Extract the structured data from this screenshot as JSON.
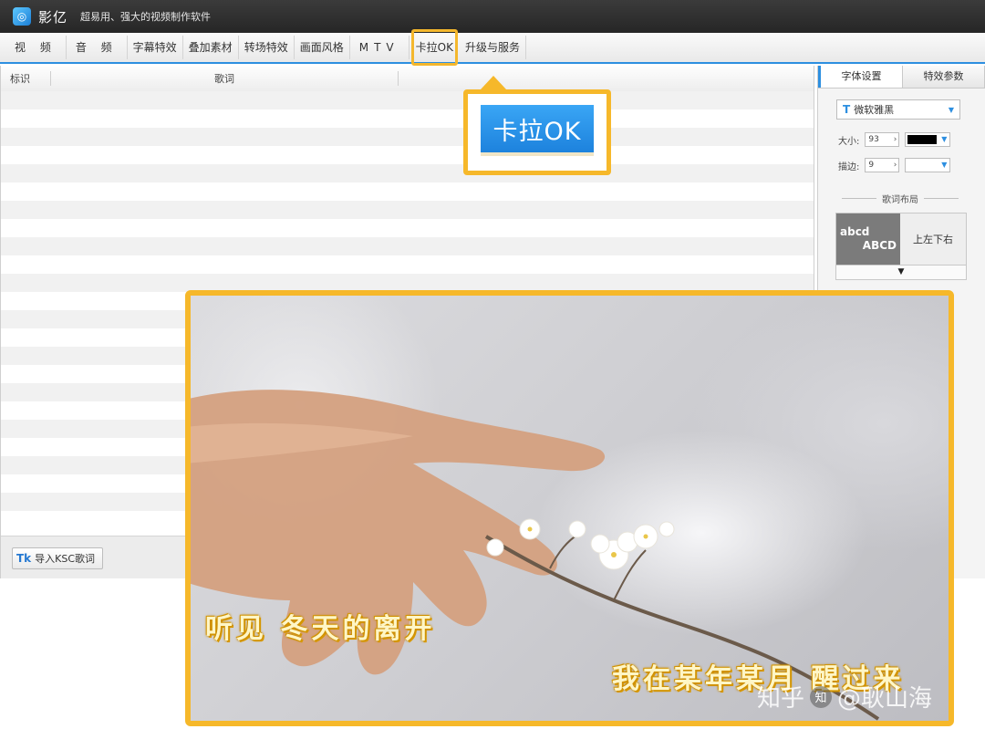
{
  "app": {
    "name": "影亿",
    "slogan": "超易用、强大的视频制作软件",
    "logo_glyph": "◎"
  },
  "tabs": [
    {
      "label": "视 频",
      "active": false
    },
    {
      "label": "音 频",
      "active": false
    },
    {
      "label": "字幕特效",
      "active": false
    },
    {
      "label": "叠加素材",
      "active": false
    },
    {
      "label": "转场特效",
      "active": false
    },
    {
      "label": "画面风格",
      "active": false
    },
    {
      "label": "MTV",
      "active": false
    },
    {
      "label": "卡拉OK",
      "active": true
    },
    {
      "label": "升级与服务",
      "active": false
    }
  ],
  "lyrics_table": {
    "col_id": "标识",
    "col_lyric": "歌词"
  },
  "import_button": {
    "icon": "Tk",
    "label": "导入KSC歌词"
  },
  "settings": {
    "tab_font": "字体设置",
    "tab_effect": "特效参数",
    "font_icon": "T",
    "font_name": "微软雅黑",
    "size_label": "大小:",
    "size_value": "93",
    "size_color": "#000000",
    "stroke_label": "描边:",
    "stroke_value": "9",
    "stroke_color": "#ffffff",
    "layout_title": "歌词布局",
    "layout_sample_1": "abcd",
    "layout_sample_2": "ABCD",
    "layout_option": "上左下右",
    "layout_more": "▼"
  },
  "callout": {
    "label": "卡拉OK"
  },
  "preview": {
    "lyric_1": "听见 冬天的离开",
    "lyric_2": "我在某年某月 醒过来",
    "watermark_site": "知乎",
    "watermark_user": "@耿山海"
  }
}
